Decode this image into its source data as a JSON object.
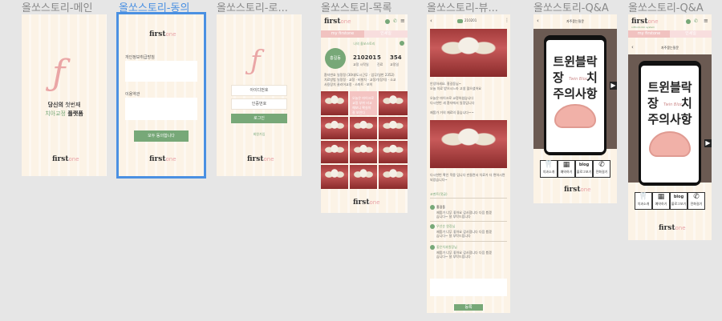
{
  "screens": {
    "main": {
      "label": "올쏘스토리-메인",
      "tagline_1_bold": "당신의",
      "tagline_1_rest": " 첫번째",
      "tagline_2_green": "치아교정",
      "tagline_2_bold": " 플랫폼",
      "logo_first": "first",
      "logo_one": "one"
    },
    "agree": {
      "label": "올쏘스토리-동의",
      "logo_first": "first",
      "logo_one": "one",
      "privacy_title": "개인정보취급방침",
      "terms_title": "이용약관",
      "agree_button": "모두 동의합니다",
      "footer_first": "first",
      "footer_one": "one"
    },
    "login": {
      "label": "올쏘스토리-로...",
      "id_placeholder": "아이디번호",
      "pw_placeholder": "인증번호",
      "login_button": "로그인",
      "signup_link": "회원가입",
      "footer_first": "first",
      "footer_one": "one"
    },
    "list": {
      "label": "올쏘스토리-목록",
      "logo_first": "first",
      "logo_one": "one",
      "tab_my": "my firstone",
      "tab_other": "인세일",
      "section_title": "나의 올쏘스토리",
      "name": "홍길동",
      "stats": [
        {
          "value": "210201",
          "label": "교정 시작일"
        },
        {
          "value": "5",
          "label": "진료"
        },
        {
          "value": "354",
          "label": "교정일"
        }
      ],
      "info_rows": [
        "환자번호  일정정 (30대/도시근무 · 업무/일반 2352)",
        "치료방법  일정정 · 교정 · 비발치 · 교정기(장치) · 소교",
        "사용장치  클리어교정 · 스마트 · 보이"
      ],
      "overlay_text": "오늘은 마이크로 교정 부위 비교해보니 확실히 잘 보인다",
      "footer_first": "first",
      "footer_one": "one"
    },
    "view": {
      "label": "올쏘스토리-뷰...",
      "badge": "210201",
      "text_1": "안녕하세요. 홍길동님~\n오늘 치료 받으시느라 고생 많으셨어요",
      "text_2": "오늘은 마이크로 교정하셨습니다\n다시한번 새 환자에서 일정입니다",
      "text_3": "제품가 거의 재료의 좋습니다~~",
      "text_4": "다시한번 확인 적용 입니다 만들면서 치료가 더 편하시면 되었습니다~",
      "comments_header": "코멘트(댓글)",
      "comments": [
        {
          "name": "홍길동",
          "text": "제품가 너무 좋아요 감사합니다 다음 뵙겠습니다~ 잘 부탁드립니다"
        },
        {
          "name": "우선순 원장님",
          "text": "제품가 너무 좋아요 감사합니다 다음 뵙겠습니다~ 잘 부탁드립니다"
        },
        {
          "name": "좋은치과원장님",
          "text": "제품가 너무 좋아요 감사합니다 다음 뵙겠습니다~ 잘 부탁드립니다"
        }
      ],
      "submit_button": "등록"
    },
    "qna": {
      "label": "올쏘스토리-Q&A",
      "title": "자주묻는질문",
      "banner_line1": "트윈블락",
      "banner_line2a": "장",
      "banner_line2b": "치",
      "banner_line3": "주의사항",
      "banner_sub": "Twin Bloc",
      "icons": [
        "치과소개",
        "예약하기",
        "블로그보기",
        "전화걸기"
      ],
      "icon_blog": "blog",
      "footer_first": "first",
      "footer_one": "one",
      "next_arrow": "▶"
    },
    "qna2": {
      "label": "올쏘스토리-Q&A",
      "logo_first": "first",
      "logo_one": "one",
      "logo_sub": "orthodontic system",
      "tab_my": "my firstone",
      "tab_other": "인세일",
      "title": "자주묻는질문",
      "banner_line1": "트윈블락",
      "banner_line2a": "장",
      "banner_line2b": "치",
      "banner_line3": "주의사항",
      "banner_sub": "Twin Bloc",
      "icons": [
        "치과소개",
        "예약하기",
        "블로그보기",
        "전화걸기"
      ],
      "icon_blog": "blog",
      "footer_first": "first",
      "footer_one": "one",
      "next_arrow": "▶"
    }
  }
}
